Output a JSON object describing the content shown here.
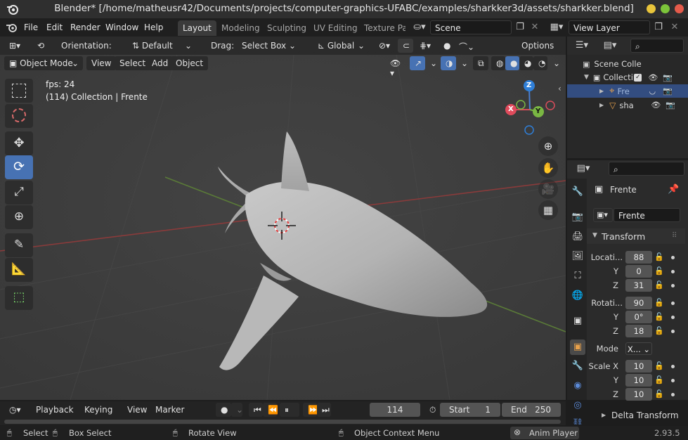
{
  "window": {
    "title": "Blender* [/home/matheusr42/Documents/projects/computer-graphics-UFABC/examples/sharkker3d/assets/sharkker.blend]",
    "buttons": {
      "minimize_color": "#e9c53b",
      "maximize_color": "#7cc43a",
      "close_color": "#e55b4b"
    }
  },
  "menubar": {
    "items": [
      "File",
      "Edit",
      "Render",
      "Window",
      "Help"
    ],
    "workspaces": [
      "Layout",
      "Modeling",
      "Sculpting",
      "UV Editing",
      "Texture Pa"
    ],
    "active_workspace": "Layout",
    "scene": "Scene",
    "view_layer": "View Layer"
  },
  "tool_header": {
    "orientation_label": "Orientation:",
    "orientation_value": "Default",
    "drag_label": "Drag:",
    "drag_value": "Select Box",
    "transform_value": "Global",
    "options_label": "Options"
  },
  "viewport_header": {
    "mode": "Object Mode",
    "menus": [
      "View",
      "Select",
      "Add",
      "Object"
    ]
  },
  "viewport": {
    "fps_text": "fps: 24",
    "context_text": "(114) Collection | Frente",
    "gizmo_axes": {
      "x": "X",
      "y": "Y",
      "z": "Z"
    },
    "background_color": "#3d3d3d",
    "x_axis_color": "#8a3b3b",
    "y_axis_color": "#5a7a38"
  },
  "outliner": {
    "scene_collection": "Scene Colle",
    "collection": "Collecti",
    "items": [
      {
        "name": "Fre",
        "selected": true
      },
      {
        "name": "sha",
        "selected": false
      }
    ]
  },
  "properties": {
    "object_name": "Frente",
    "data_name": "Frente",
    "transform_header": "Transform",
    "location_label": "Locati...",
    "location": {
      "x": "88",
      "y": "0",
      "z": "31"
    },
    "rotation_label": "Rotati...",
    "rotation": {
      "x": "90",
      "y": "0°",
      "z": "18"
    },
    "mode_label": "Mode",
    "mode_value": "X...",
    "scale_label": "Scale X",
    "scale": {
      "x": "10",
      "y": "10",
      "z": "10"
    },
    "axis_labels": {
      "y": "Y",
      "z": "Z"
    },
    "delta_transform": "Delta Transform"
  },
  "timeline": {
    "menus": [
      "Playback",
      "Keying",
      "View",
      "Marker"
    ],
    "current_frame": "114",
    "start_label": "Start",
    "start_value": "1",
    "end_label": "End",
    "end_value": "250"
  },
  "statusbar": {
    "select": "Select",
    "box_select": "Box Select",
    "rotate_view": "Rotate View",
    "context_menu": "Object Context Menu",
    "anim_player": "Anim Player",
    "version": "2.93.5"
  }
}
